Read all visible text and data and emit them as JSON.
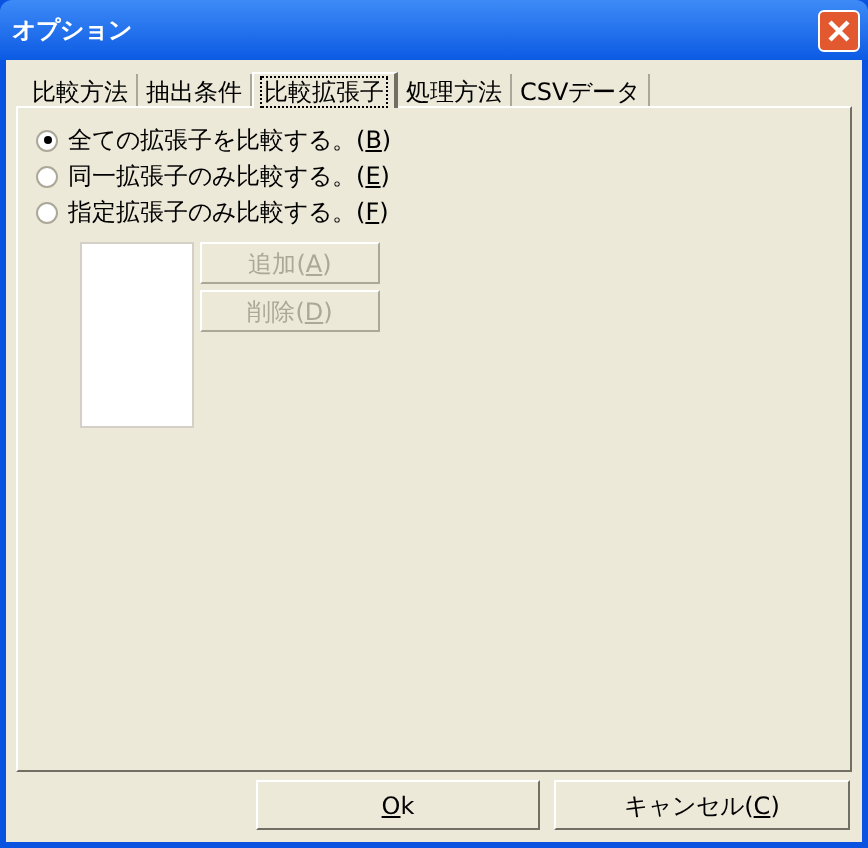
{
  "window": {
    "title": "オプション"
  },
  "tabs": [
    {
      "label": "比較方法",
      "selected": false
    },
    {
      "label": "抽出条件",
      "selected": false
    },
    {
      "label": "比較拡張子",
      "selected": true
    },
    {
      "label": "処理方法",
      "selected": false
    },
    {
      "label": "CSVデータ",
      "selected": false
    }
  ],
  "options": [
    {
      "label": "全ての拡張子を比較する。(",
      "key": "B",
      "tail": ")",
      "selected": true
    },
    {
      "label": "同一拡張子のみ比較する。(",
      "key": "E",
      "tail": ")",
      "selected": false
    },
    {
      "label": "指定拡張子のみ比較する。(",
      "key": "F",
      "tail": ")",
      "selected": false
    }
  ],
  "list_buttons": [
    {
      "label": "追加(",
      "key": "A",
      "tail": ")",
      "disabled": true
    },
    {
      "label": "削除(",
      "key": "D",
      "tail": ")",
      "disabled": true
    }
  ],
  "footer_buttons": [
    {
      "key": "O",
      "tail": "k"
    },
    {
      "label": "キャンセル(",
      "key": "C",
      "tail": ")"
    }
  ]
}
